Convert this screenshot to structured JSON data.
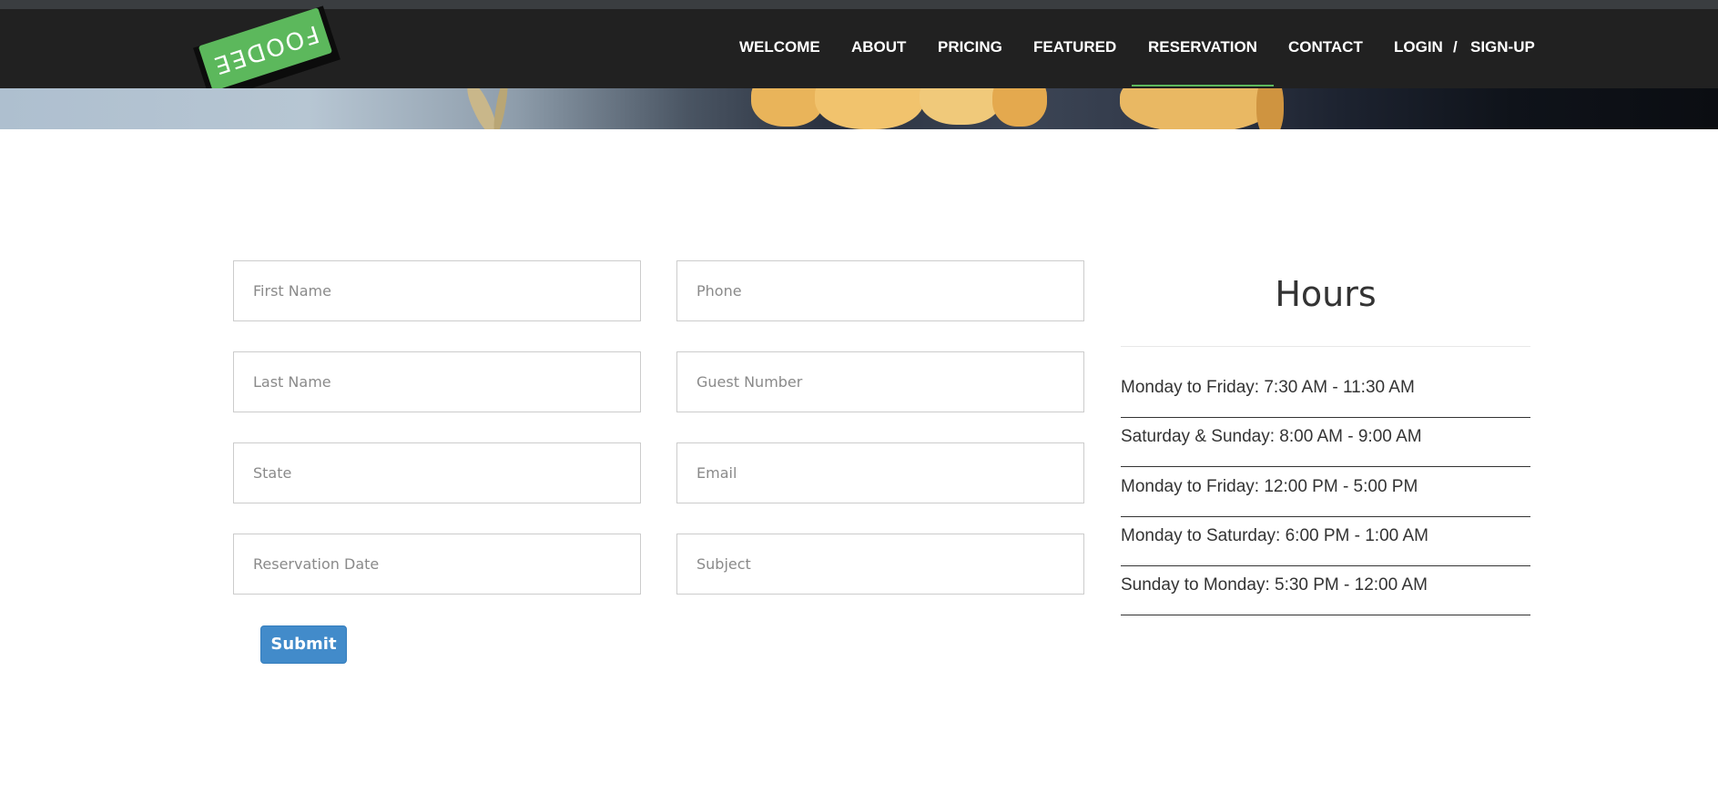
{
  "brand": {
    "logo_text": "FOODEE"
  },
  "nav": {
    "items": [
      {
        "label": "WELCOME"
      },
      {
        "label": "ABOUT"
      },
      {
        "label": "PRICING"
      },
      {
        "label": "FEATURED"
      },
      {
        "label": "RESERVATION",
        "active": true
      },
      {
        "label": "CONTACT"
      }
    ],
    "login": "LOGIN",
    "separator": "/",
    "signup": "SIGN-UP"
  },
  "form": {
    "first_name_placeholder": "First Name",
    "phone_placeholder": "Phone",
    "last_name_placeholder": "Last Name",
    "guest_number_placeholder": "Guest Number",
    "state_placeholder": "State",
    "email_placeholder": "Email",
    "reservation_date_placeholder": "Reservation Date",
    "subject_placeholder": "Subject",
    "submit_label": "Submit"
  },
  "hours": {
    "title": "Hours",
    "rows": [
      "Monday to Friday: 7:30 AM - 11:30 AM",
      "Saturday & Sunday: 8:00 AM - 9:00 AM",
      "Monday to Friday: 12:00 PM - 5:00 PM",
      "Monday to Saturday: 6:00 PM - 1:00 AM",
      "Sunday to Monday: 5:30 PM - 12:00 AM"
    ]
  },
  "colors": {
    "accent_green": "#5cb85c",
    "button_blue": "#428bca",
    "navbar_bg": "#212121"
  }
}
